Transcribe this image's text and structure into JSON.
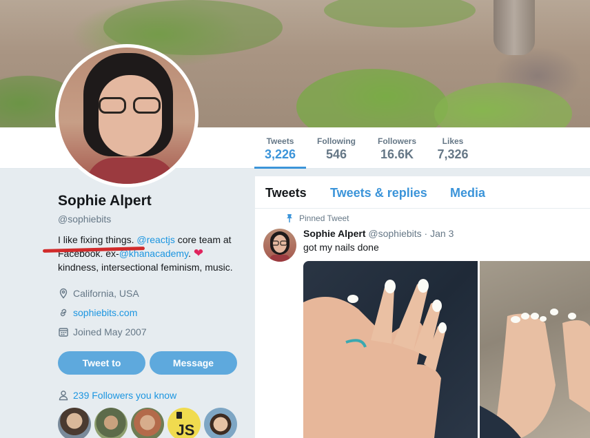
{
  "profile": {
    "name": "Sophie Alpert",
    "handle": "@sophiebits",
    "bio": {
      "part1": "I like fixing things. ",
      "mention1": "@reactjs",
      "part2": " core team at Facebook. ex-",
      "mention2": "@khanacademy",
      "part3": ". ",
      "part4": " kindness, intersectional feminism, music."
    },
    "location": "California, USA",
    "website": "sophiebits.com",
    "joined": "Joined May 2007",
    "tweet_to_label": "Tweet to",
    "message_label": "Message",
    "followers_you_know": "239 Followers you know",
    "known_faces": [
      "face-1",
      "face-2",
      "face-3",
      "js-logo",
      "face-5"
    ],
    "js_logo_text": "JS"
  },
  "stats": [
    {
      "label": "Tweets",
      "value": "3,226"
    },
    {
      "label": "Following",
      "value": "546"
    },
    {
      "label": "Followers",
      "value": "16.6K"
    },
    {
      "label": "Likes",
      "value": "7,326"
    }
  ],
  "timeline": {
    "tabs": [
      "Tweets",
      "Tweets & replies",
      "Media"
    ],
    "pinned_label": "Pinned Tweet",
    "tweet": {
      "name": "Sophie Alpert",
      "handle": "@sophiebits",
      "separator": " · ",
      "date": "Jan 3",
      "text": "got my nails done"
    }
  },
  "colors": {
    "accent": "#3b94d9",
    "link": "#1b95e0",
    "button": "#5ea9dd",
    "heart": "#e0245e",
    "annotation_underline": "#d12b2b"
  },
  "icons": {
    "location": "location-pin-icon",
    "website": "link-icon",
    "joined": "calendar-icon",
    "followers": "person-icon",
    "pinned": "pin-icon",
    "heart": "heart-icon"
  }
}
